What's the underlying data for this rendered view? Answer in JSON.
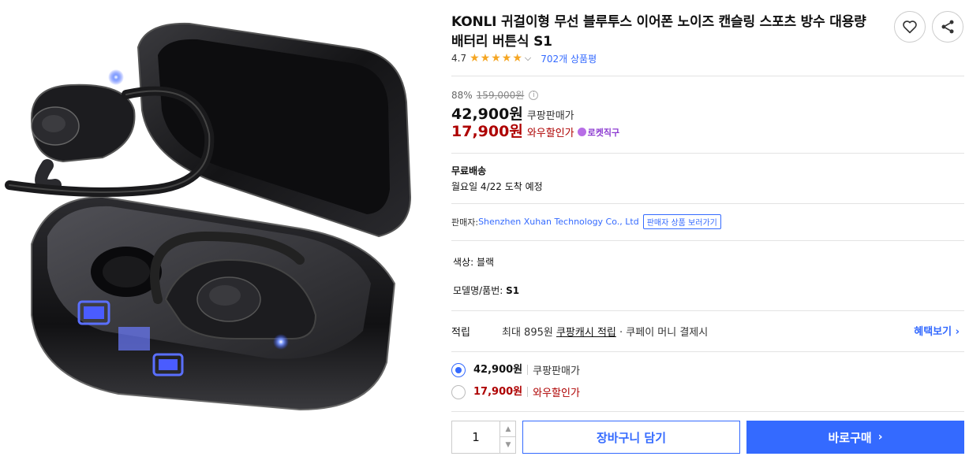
{
  "product": {
    "title": "KONLI 귀걸이형 무선 블루투스 이어폰 노이즈 캔슬링 스포츠 방수 대용량 배터리 버튼식 S1",
    "rating": "4.7",
    "stars": 5,
    "review_count": "702개 상품평",
    "image_alt_icon": "earbuds-case-image"
  },
  "actions": {
    "wishlist_icon": "heart-icon",
    "share_icon": "share-icon"
  },
  "pricing": {
    "discount_rate": "88%",
    "original_price": "159,000원",
    "info_glyph": "i",
    "main_price": "42,900원",
    "main_label": "쿠팡판매가",
    "sale_price": "17,900원",
    "sale_label": "와우할인가",
    "rocket_badge": "로켓직구"
  },
  "shipping": {
    "title": "무료배송",
    "eta": "월요일 4/22 도착 예정"
  },
  "seller": {
    "label": "판매자: ",
    "name": "Shenzhen Xuhan Technology Co., Ltd",
    "button": "판매자 상품 보러가기"
  },
  "options": {
    "color_label": "색상: ",
    "color_value": "블랙",
    "model_label": "모델명/품번: ",
    "model_value": "S1"
  },
  "cash": {
    "label": "적립",
    "prefix": "최대 895원 ",
    "link": "쿠팡캐시 적립",
    "suffix": " · 쿠페이 머니 결제시",
    "benefit": "혜택보기 ›"
  },
  "price_options": [
    {
      "price": "42,900원",
      "label": "쿠팡판매가",
      "selected": true
    },
    {
      "price": "17,900원",
      "label": "와우할인가",
      "selected": false
    }
  ],
  "purchase": {
    "quantity": "1",
    "cart_button": "장바구니 담기",
    "buy_button": "바로구매",
    "buy_arrow": "›"
  },
  "colors": {
    "accent": "#346aff",
    "sale_red": "#ae0000",
    "star": "#f5a623",
    "rocket_purple": "#8c3bd1"
  }
}
